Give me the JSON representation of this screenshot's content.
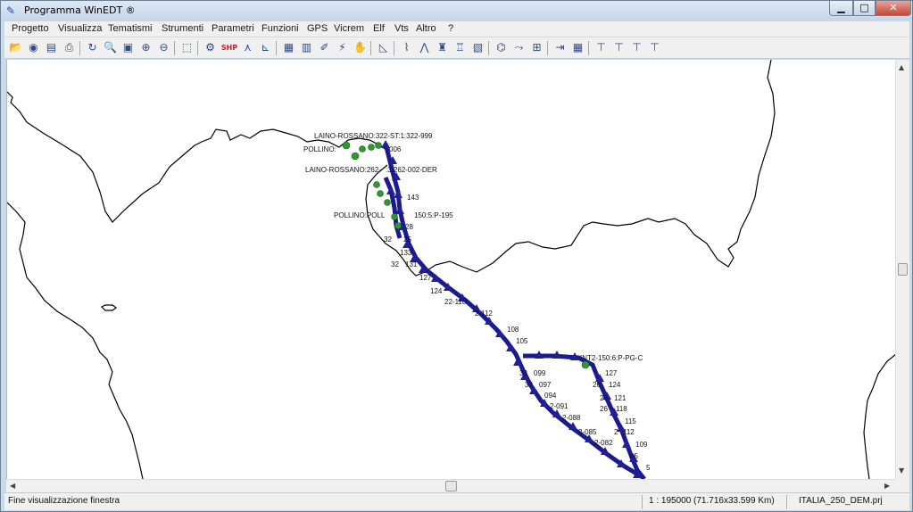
{
  "window": {
    "title": "Programma WinEDT ®",
    "app_icon": "winedt-logo-icon"
  },
  "window_controls": {
    "minimize": "▁",
    "maximize": "□",
    "close": "✕"
  },
  "menu": {
    "items": [
      {
        "label": "Progetto"
      },
      {
        "label": "Visualizza"
      },
      {
        "label": "Tematismi"
      },
      {
        "label": "Strumenti"
      },
      {
        "label": "Parametri"
      },
      {
        "label": "Funzioni"
      },
      {
        "label": "GPS"
      },
      {
        "label": "Vicrem"
      },
      {
        "label": "Elf"
      },
      {
        "label": "Vts"
      },
      {
        "label": "Altro"
      },
      {
        "label": "?"
      }
    ]
  },
  "toolbar": {
    "shp_label": "SHP",
    "tools": [
      {
        "icon": "open-folder-icon"
      },
      {
        "icon": "open-project-icon"
      },
      {
        "icon": "layers-icon"
      },
      {
        "icon": "print-icon"
      },
      {
        "icon": "refresh-icon"
      },
      {
        "icon": "print-preview-icon"
      },
      {
        "icon": "page-icon"
      },
      {
        "icon": "zoom-in-icon"
      },
      {
        "icon": "zoom-out-icon"
      },
      {
        "icon": "select-area-icon"
      },
      {
        "icon": "gear-icon"
      },
      {
        "icon": "shp-icon"
      },
      {
        "icon": "node-tool-icon"
      },
      {
        "icon": "measure-icon"
      },
      {
        "icon": "clipboard-icon"
      },
      {
        "icon": "properties-icon"
      },
      {
        "icon": "brush-icon"
      },
      {
        "icon": "lightning-icon"
      },
      {
        "icon": "pan-hand-icon"
      },
      {
        "icon": "angle-icon"
      },
      {
        "icon": "chart-icon"
      },
      {
        "icon": "profile-icon"
      },
      {
        "icon": "tower-icon"
      },
      {
        "icon": "tower-add-icon"
      },
      {
        "icon": "report-icon"
      },
      {
        "icon": "network-icon"
      },
      {
        "icon": "route-icon"
      },
      {
        "icon": "grid-tool-icon"
      },
      {
        "icon": "export-icon"
      },
      {
        "icon": "table-icon"
      },
      {
        "icon": "pylon-a-icon"
      },
      {
        "icon": "pylon-b-icon"
      },
      {
        "icon": "pylon-c-icon"
      },
      {
        "icon": "pylon-d-icon"
      }
    ]
  },
  "map": {
    "labels": [
      "LAINO-ROSSANO:322-ST:1:322-999",
      "POLLINO:",
      "006",
      "LAINO-ROSSANO:262-",
      ":3:262-002-DER",
      "143",
      "POLLINO:POLL",
      "150:5:P-195",
      "28",
      "32",
      "25",
      "133",
      "32",
      "131",
      "127",
      "124",
      "22-118",
      "2-112",
      "108",
      "105",
      "INT2-150:6:P-PG-C",
      "32",
      "099",
      "32",
      "097",
      "094",
      "2-091",
      "2-088",
      "2-085",
      "2-082",
      "127",
      "26",
      "124",
      "26",
      "121",
      "26",
      "118",
      "115",
      "2",
      "112",
      "109",
      "05",
      "5"
    ],
    "colors": {
      "line": "#1b1b8f",
      "tower": "#1f1f9a",
      "node": "#2e9a2e",
      "coast": "#000000"
    }
  },
  "status": {
    "message": "Fine visualizzazione finestra",
    "scale": "1 : 195000 (71.716x33.599 Km)",
    "project": "ITALIA_250_DEM.prj"
  }
}
